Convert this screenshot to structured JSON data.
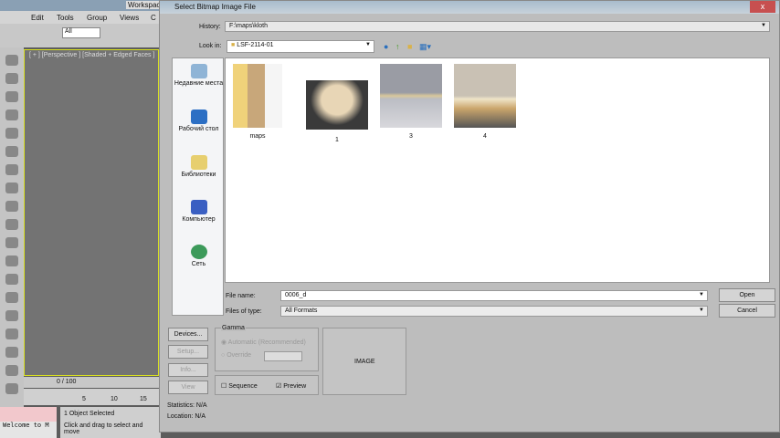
{
  "app": {
    "toolbar_workspace": "Workspace",
    "menu": [
      "Edit",
      "Tools",
      "Group",
      "Views",
      "C"
    ],
    "selection_filter": "All",
    "viewport_label": "[ + ] [Perspective ] [Shaded + Edged Faces ]",
    "time_slider": "0 / 100",
    "track_ticks": [
      "5",
      "10",
      "15"
    ],
    "status_selected": "1 Object Selected",
    "status_hint": "Click and drag to select and move",
    "listener": "Welcome to M"
  },
  "dialog": {
    "title": "Select Bitmap Image File",
    "close": "x",
    "history_label": "History:",
    "history_value": "F:\\maps\\kloth",
    "lookin_label": "Look in:",
    "lookin_value": "LSF-2114-01",
    "places": [
      {
        "label": "Недавние места",
        "icon": "recent-places-icon"
      },
      {
        "label": "Рабочий стол",
        "icon": "desktop-icon"
      },
      {
        "label": "Библиотеки",
        "icon": "libraries-icon"
      },
      {
        "label": "Компьютер",
        "icon": "computer-icon"
      },
      {
        "label": "Сеть",
        "icon": "network-icon"
      }
    ],
    "files": [
      {
        "name": "maps",
        "type": "folder"
      },
      {
        "name": "1",
        "type": "image"
      },
      {
        "name": "3",
        "type": "image"
      },
      {
        "name": "4",
        "type": "image"
      }
    ],
    "filename_label": "File name:",
    "filename_value": "0006_d",
    "filetype_label": "Files of type:",
    "filetype_value": "All Formats",
    "open": "Open",
    "cancel": "Cancel",
    "devices": "Devices...",
    "setup": "Setup...",
    "info": "Info...",
    "view": "View",
    "gamma_title": "Gamma",
    "gamma_auto": "Automatic (Recommended)",
    "gamma_override": "Override",
    "sequence": "Sequence",
    "preview": "Preview",
    "preview_placeholder": "IMAGE",
    "statistics": "Statistics: N/A",
    "location": "Location: N/A"
  }
}
